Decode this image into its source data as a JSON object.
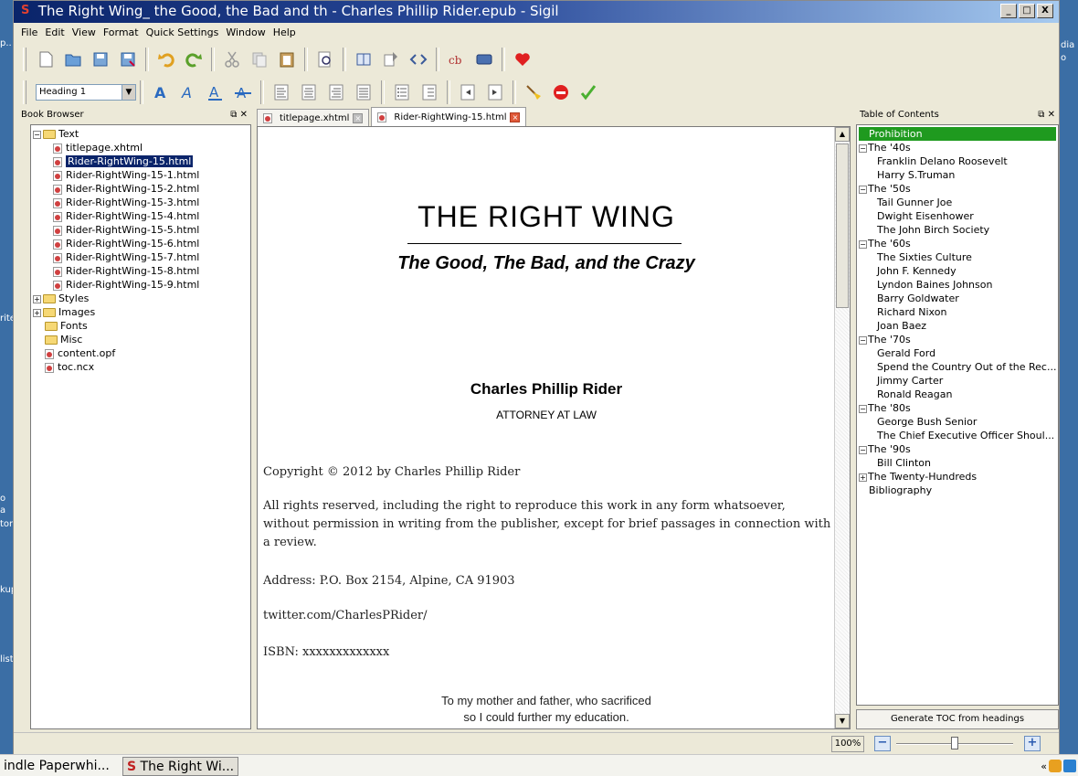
{
  "desktop": {
    "left_labels": [
      "p..",
      "rite",
      "o",
      "a",
      "tor",
      "kup",
      "list"
    ],
    "right_labels": [
      "dia",
      "o"
    ]
  },
  "window": {
    "title": "The Right Wing_ the Good, the Bad and th - Charles Phillip Rider.epub - Sigil",
    "app_glyph": "S",
    "controls": {
      "minimize": "_",
      "maximize": "□",
      "close": "X"
    }
  },
  "menu": [
    "File",
    "Edit",
    "View",
    "Format",
    "Quick Settings",
    "Window",
    "Help"
  ],
  "toolbar": {
    "heading_select": "Heading 1"
  },
  "book_browser": {
    "title": "Book Browser",
    "controls": "⧉ ✕",
    "tree": [
      {
        "label": "Text",
        "type": "folder",
        "expanded": true,
        "level": 0
      },
      {
        "label": "titlepage.xhtml",
        "type": "file",
        "level": 1
      },
      {
        "label": "Rider-RightWing-15.html",
        "type": "file",
        "level": 1,
        "selected": true
      },
      {
        "label": "Rider-RightWing-15-1.html",
        "type": "file",
        "level": 1
      },
      {
        "label": "Rider-RightWing-15-2.html",
        "type": "file",
        "level": 1
      },
      {
        "label": "Rider-RightWing-15-3.html",
        "type": "file",
        "level": 1
      },
      {
        "label": "Rider-RightWing-15-4.html",
        "type": "file",
        "level": 1
      },
      {
        "label": "Rider-RightWing-15-5.html",
        "type": "file",
        "level": 1
      },
      {
        "label": "Rider-RightWing-15-6.html",
        "type": "file",
        "level": 1
      },
      {
        "label": "Rider-RightWing-15-7.html",
        "type": "file",
        "level": 1
      },
      {
        "label": "Rider-RightWing-15-8.html",
        "type": "file",
        "level": 1
      },
      {
        "label": "Rider-RightWing-15-9.html",
        "type": "file",
        "level": 1
      },
      {
        "label": "Styles",
        "type": "folder",
        "expanded": false,
        "level": 0
      },
      {
        "label": "Images",
        "type": "folder",
        "expanded": false,
        "level": 0
      },
      {
        "label": "Fonts",
        "type": "folder",
        "level": 0
      },
      {
        "label": "Misc",
        "type": "folder",
        "level": 0
      },
      {
        "label": "content.opf",
        "type": "opf",
        "level": 0
      },
      {
        "label": "toc.ncx",
        "type": "ncx",
        "level": 0
      }
    ]
  },
  "tabs": [
    {
      "label": "titlepage.xhtml",
      "active": false
    },
    {
      "label": "Rider-RightWing-15.html",
      "active": true
    }
  ],
  "document": {
    "title": "THE RIGHT WING",
    "subtitle": "The Good, The Bad, and the Crazy",
    "author": "Charles Phillip Rider",
    "author_role": "ATTORNEY AT LAW",
    "copyright": "Copyright © 2012 by Charles Phillip Rider",
    "rights": "All rights reserved, including the right to reproduce this work in any form whatsoever, without permission in writing from the publisher, except for brief passages in connection with a review.",
    "address": "Address: P.O. Box 2154, Alpine, CA 91903",
    "twitter": "twitter.com/CharlesPRider/",
    "isbn": "ISBN: xxxxxxxxxxxxx",
    "dedication_1": "To my mother and father, who sacrificed",
    "dedication_2": "so I could further my education."
  },
  "toc": {
    "title": "Table of Contents",
    "controls": "⧉ ✕",
    "items": [
      {
        "label": "Prohibition",
        "level": 0,
        "selected": true
      },
      {
        "label": "The '40s",
        "level": 0,
        "toggle": "-"
      },
      {
        "label": "Franklin Delano Roosevelt",
        "level": 1
      },
      {
        "label": "Harry S.Truman",
        "level": 1
      },
      {
        "label": "The '50s",
        "level": 0,
        "toggle": "-"
      },
      {
        "label": "Tail Gunner Joe",
        "level": 1
      },
      {
        "label": "Dwight Eisenhower",
        "level": 1
      },
      {
        "label": "The John Birch Society",
        "level": 1
      },
      {
        "label": "The '60s",
        "level": 0,
        "toggle": "-"
      },
      {
        "label": "The Sixties Culture",
        "level": 1
      },
      {
        "label": "John F. Kennedy",
        "level": 1
      },
      {
        "label": "Lyndon Baines Johnson",
        "level": 1
      },
      {
        "label": "Barry Goldwater",
        "level": 1
      },
      {
        "label": "Richard Nixon",
        "level": 1
      },
      {
        "label": "Joan Baez",
        "level": 1
      },
      {
        "label": "The '70s",
        "level": 0,
        "toggle": "-"
      },
      {
        "label": "Gerald Ford",
        "level": 1
      },
      {
        "label": "Spend the Country Out of the Rec...",
        "level": 1
      },
      {
        "label": "Jimmy Carter",
        "level": 1
      },
      {
        "label": "Ronald Reagan",
        "level": 1
      },
      {
        "label": "The '80s",
        "level": 0,
        "toggle": "-"
      },
      {
        "label": "George Bush Senior",
        "level": 1
      },
      {
        "label": "The Chief Executive Officer Shoul...",
        "level": 1
      },
      {
        "label": "The '90s",
        "level": 0,
        "toggle": "-"
      },
      {
        "label": "Bill Clinton",
        "level": 1
      },
      {
        "label": "The Twenty-Hundreds",
        "level": 0,
        "toggle": "+"
      },
      {
        "label": "Bibliography",
        "level": 0
      }
    ],
    "generate_button": "Generate TOC from headings"
  },
  "status": {
    "zoom": "100%",
    "zoom_out": "−",
    "zoom_in": "+",
    "zoom_level_fraction": 0.5
  },
  "taskbar": {
    "item1": "indle Paperwhi...",
    "item2_glyph": "S",
    "item2": "The Right Wi...",
    "tray_arrow": "«"
  },
  "colors": {
    "toc_selected": "#1f9a1f",
    "tree_selected": "#0a246a",
    "title_bar": "#0a246a"
  }
}
